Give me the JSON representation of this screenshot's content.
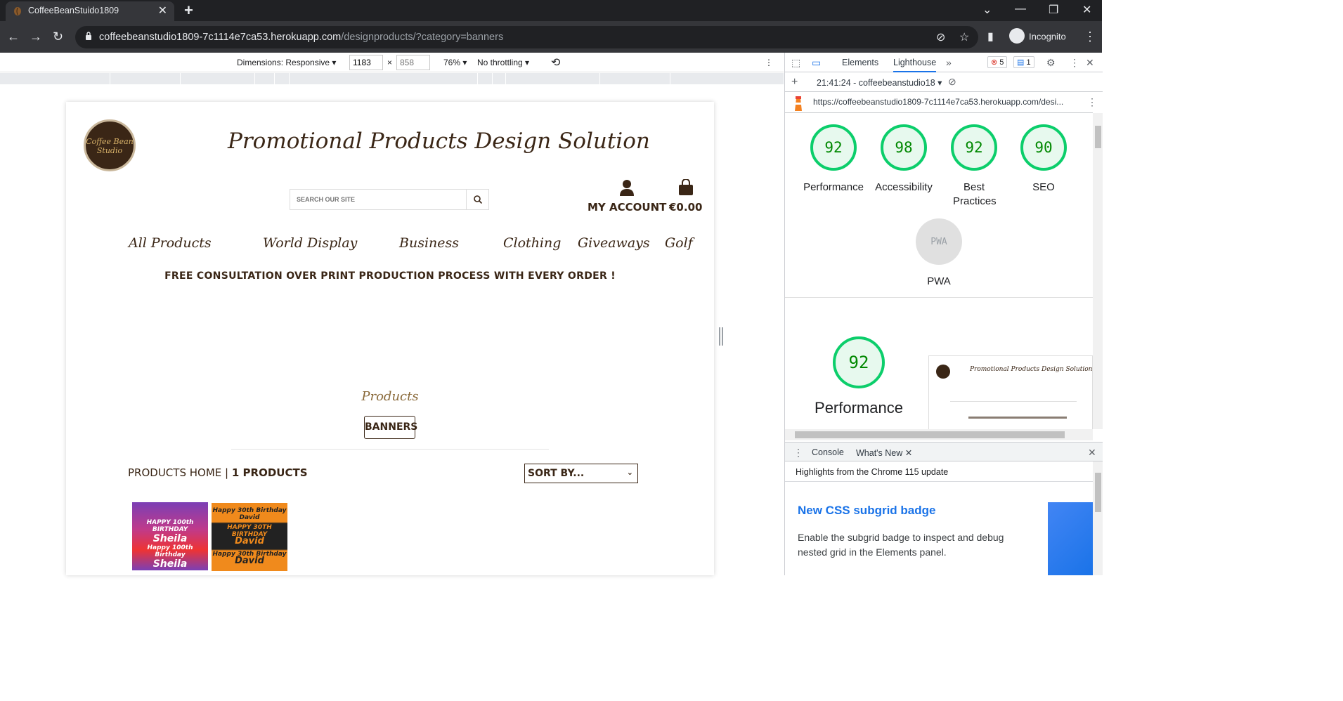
{
  "browser": {
    "tab_title": "CoffeeBeanStuido1809",
    "url_host": "coffeebeanstudio1809-7c1114e7ca53.herokuapp.com",
    "url_path": "/designproducts/?category=banners",
    "incognito_label": "Incognito"
  },
  "device_toolbar": {
    "dimensions_label": "Dimensions: Responsive",
    "width_value": "1183",
    "height_placeholder": "858",
    "zoom": "76%",
    "throttling": "No throttling"
  },
  "site": {
    "logo_text": "Coffee Bean Studio",
    "title": "Promotional Products Design Solution",
    "search_placeholder": "SEARCH OUR SITE",
    "account_label": "MY ACCOUNT",
    "bag_total": "€0.00",
    "nav": [
      "All Products",
      "World Display",
      "Business",
      "Clothing",
      "Giveaways",
      "Golf"
    ],
    "promo": "FREE CONSULTATION OVER PRINT PRODUCTION PROCESS WITH EVERY ORDER !",
    "products_heading": "Products",
    "category_badge": "BANNERS",
    "products_home": "PRODUCTS HOME",
    "separator": "|",
    "product_count": "1 PRODUCTS",
    "sort_label": "SORT BY...",
    "banners": [
      {
        "lines": [
          "HAPPY 100th BIRTHDAY",
          "Sheila",
          "Happy 100th Birthday",
          "Sheila"
        ],
        "color": "#7b3fb5"
      },
      {
        "lines": [
          "Happy 30th Birthday",
          "David",
          "HAPPY 30TH BIRTHDAY",
          "David",
          "Happy 30th Birthday",
          "David"
        ],
        "color": "#f08a1c"
      }
    ]
  },
  "devtools": {
    "tabs": [
      "Elements",
      "Lighthouse"
    ],
    "error_count": "5",
    "message_count": "1",
    "report_label": "21:41:24 - coffeebeanstudio18",
    "report_url": "https://coffeebeanstudio1809-7c1114e7ca53.herokuapp.com/desi...",
    "scores": [
      {
        "label": "Performance",
        "value": "92"
      },
      {
        "label": "Accessibility",
        "value": "98"
      },
      {
        "label": "Best Practices",
        "value": "92"
      },
      {
        "label": "SEO",
        "value": "90"
      }
    ],
    "pwa_label": "PWA",
    "pwa_badge": "PWA",
    "big_score": {
      "label": "Performance",
      "value": "92"
    },
    "thumb_title": "Promotional Products Design Solution",
    "drawer_tabs": [
      "Console",
      "What's New"
    ],
    "whatsnew_sub": "Highlights from the Chrome 115 update",
    "whatsnew_heading": "New CSS subgrid badge",
    "whatsnew_text": "Enable the subgrid badge to inspect and debug nested grid in the Elements panel."
  },
  "colors": {
    "brand_brown": "#3a2616",
    "score_green": "#0cce6b",
    "link_blue": "#1a73e8"
  }
}
